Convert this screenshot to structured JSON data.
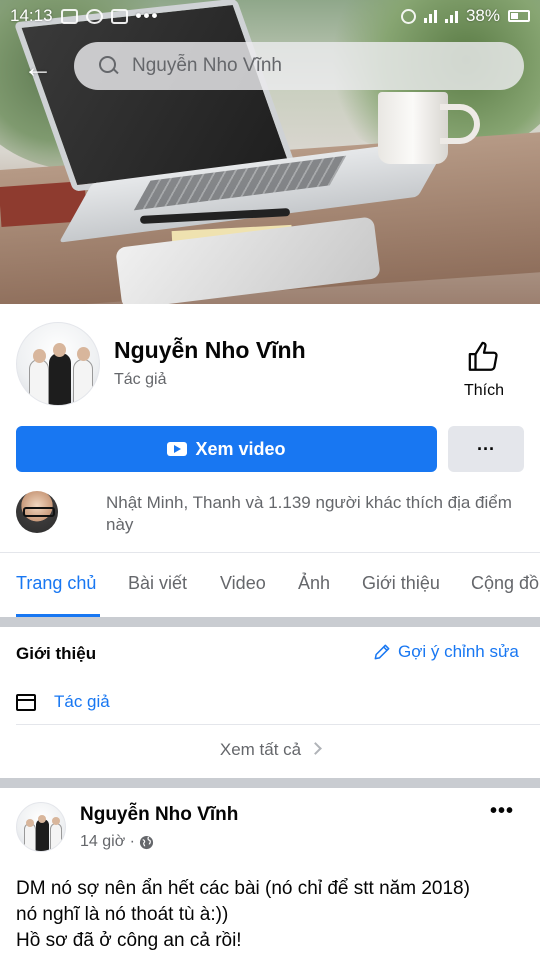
{
  "status_bar": {
    "time": "14:13",
    "notification_dots": "•••",
    "battery_percent": "38%"
  },
  "search": {
    "value": "Nguyễn Nho Vĩnh"
  },
  "profile": {
    "name": "Nguyễn Nho Vĩnh",
    "category": "Tác giả",
    "like_label": "Thích",
    "watch_button_label": "Xem video",
    "more_button_label": "···",
    "likes_summary": "Nhật Minh, Thanh và 1.139 người khác thích địa điểm này"
  },
  "tabs": [
    {
      "label": "Trang chủ",
      "active": true
    },
    {
      "label": "Bài viết",
      "active": false
    },
    {
      "label": "Video",
      "active": false
    },
    {
      "label": "Ảnh",
      "active": false
    },
    {
      "label": "Giới thiệu",
      "active": false
    },
    {
      "label": "Cộng đồ",
      "active": false
    }
  ],
  "about": {
    "title": "Giới thiệu",
    "suggest_edit_label": "Gợi ý chỉnh sửa",
    "category_label": "Tác giả",
    "see_all_label": "Xem tất cả"
  },
  "post": {
    "author": "Nguyễn Nho Vĩnh",
    "time": "14 giờ ·",
    "menu_label": "•••",
    "lines": [
      "DM nó sợ nên ẩn hết các bài (nó chỉ để stt năm 2018)",
      "nó nghĩ là nó thoát tù à:))",
      "Hồ sơ đã ở công an cả rồi!"
    ]
  },
  "colors": {
    "brand_blue": "#1877f2",
    "secondary_text": "#65676b",
    "separator": "#c9ccd1",
    "button_gray": "#e4e6eb"
  },
  "icons": {
    "back": "back-arrow-icon",
    "search": "search-icon",
    "like": "thumbs-up-icon",
    "watch": "play-icon",
    "suggest_edit": "pencil-icon",
    "category": "category-icon",
    "see_all": "chevron-right-icon",
    "privacy": "globe-icon"
  }
}
